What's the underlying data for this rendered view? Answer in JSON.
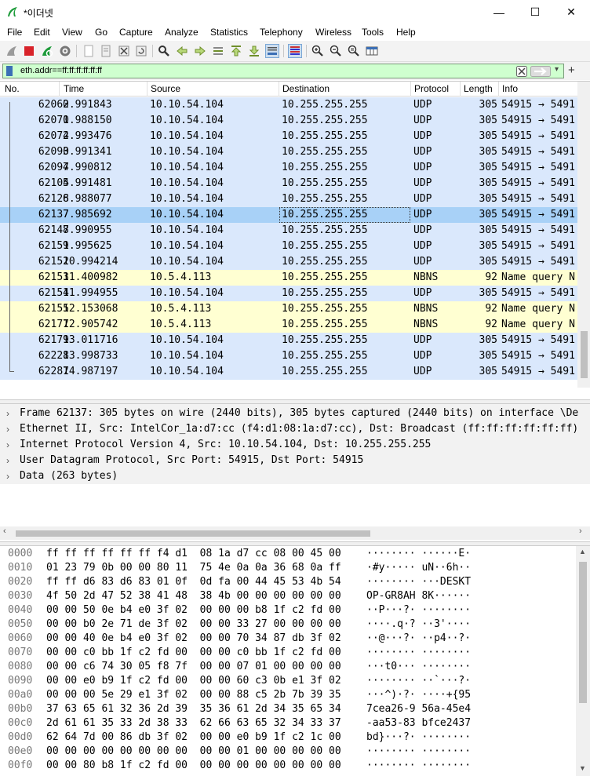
{
  "window": {
    "title": "*이더넷",
    "minimize": "—",
    "maximize": "☐",
    "close": "✕"
  },
  "menu": [
    "File",
    "Edit",
    "View",
    "Go",
    "Capture",
    "Analyze",
    "Statistics",
    "Telephony",
    "Wireless",
    "Tools",
    "Help"
  ],
  "filter": {
    "value": "eth.addr==ff:ff:ff:ff:ff:ff"
  },
  "columns": {
    "no": "No.",
    "time": "Time",
    "source": "Source",
    "destination": "Destination",
    "protocol": "Protocol",
    "length": "Length",
    "info": "Info"
  },
  "packets": [
    {
      "no": "62062",
      "time": "0.991843",
      "src": "10.10.54.104",
      "dst": "10.255.255.255",
      "proto": "UDP",
      "len": "305",
      "info": "54915 → 5491"
    },
    {
      "no": "62070",
      "time": "1.988150",
      "src": "10.10.54.104",
      "dst": "10.255.255.255",
      "proto": "UDP",
      "len": "305",
      "info": "54915 → 5491"
    },
    {
      "no": "62074",
      "time": "2.993476",
      "src": "10.10.54.104",
      "dst": "10.255.255.255",
      "proto": "UDP",
      "len": "305",
      "info": "54915 → 5491"
    },
    {
      "no": "62090",
      "time": "3.991341",
      "src": "10.10.54.104",
      "dst": "10.255.255.255",
      "proto": "UDP",
      "len": "305",
      "info": "54915 → 5491"
    },
    {
      "no": "62097",
      "time": "4.990812",
      "src": "10.10.54.104",
      "dst": "10.255.255.255",
      "proto": "UDP",
      "len": "305",
      "info": "54915 → 5491"
    },
    {
      "no": "62104",
      "time": "5.991481",
      "src": "10.10.54.104",
      "dst": "10.255.255.255",
      "proto": "UDP",
      "len": "305",
      "info": "54915 → 5491"
    },
    {
      "no": "62128",
      "time": "6.988077",
      "src": "10.10.54.104",
      "dst": "10.255.255.255",
      "proto": "UDP",
      "len": "305",
      "info": "54915 → 5491"
    },
    {
      "no": "62137",
      "time": "7.985692",
      "src": "10.10.54.104",
      "dst": "10.255.255.255",
      "proto": "UDP",
      "len": "305",
      "info": "54915 → 5491"
    },
    {
      "no": "62147",
      "time": "8.990955",
      "src": "10.10.54.104",
      "dst": "10.255.255.255",
      "proto": "UDP",
      "len": "305",
      "info": "54915 → 5491"
    },
    {
      "no": "62151",
      "time": "9.995625",
      "src": "10.10.54.104",
      "dst": "10.255.255.255",
      "proto": "UDP",
      "len": "305",
      "info": "54915 → 5491"
    },
    {
      "no": "62152",
      "time": "10.994214",
      "src": "10.10.54.104",
      "dst": "10.255.255.255",
      "proto": "UDP",
      "len": "305",
      "info": "54915 → 5491"
    },
    {
      "no": "62153",
      "time": "11.400982",
      "src": "10.5.4.113",
      "dst": "10.255.255.255",
      "proto": "NBNS",
      "len": "92",
      "info": "Name query N"
    },
    {
      "no": "62154",
      "time": "11.994955",
      "src": "10.10.54.104",
      "dst": "10.255.255.255",
      "proto": "UDP",
      "len": "305",
      "info": "54915 → 5491"
    },
    {
      "no": "62155",
      "time": "12.153068",
      "src": "10.5.4.113",
      "dst": "10.255.255.255",
      "proto": "NBNS",
      "len": "92",
      "info": "Name query N"
    },
    {
      "no": "62177",
      "time": "12.905742",
      "src": "10.5.4.113",
      "dst": "10.255.255.255",
      "proto": "NBNS",
      "len": "92",
      "info": "Name query N"
    },
    {
      "no": "62179",
      "time": "13.011716",
      "src": "10.10.54.104",
      "dst": "10.255.255.255",
      "proto": "UDP",
      "len": "305",
      "info": "54915 → 5491"
    },
    {
      "no": "62228",
      "time": "13.998733",
      "src": "10.10.54.104",
      "dst": "10.255.255.255",
      "proto": "UDP",
      "len": "305",
      "info": "54915 → 5491"
    },
    {
      "no": "62287",
      "time": "14.987197",
      "src": "10.10.54.104",
      "dst": "10.255.255.255",
      "proto": "UDP",
      "len": "305",
      "info": "54915 → 5491"
    }
  ],
  "selected_packet": "62137",
  "colors": {
    "udp": "#dae8fc",
    "nbns": "#ffffd2",
    "selected": "#a8d1f7",
    "filter_ok": "#cfffcf"
  },
  "details": [
    "Frame 62137: 305 bytes on wire (2440 bits), 305 bytes captured (2440 bits) on interface \\De",
    "Ethernet II, Src: IntelCor_1a:d7:cc (f4:d1:08:1a:d7:cc), Dst: Broadcast (ff:ff:ff:ff:ff:ff)",
    "Internet Protocol Version 4, Src: 10.10.54.104, Dst: 10.255.255.255",
    "User Datagram Protocol, Src Port: 54915, Dst Port: 54915",
    "Data (263 bytes)"
  ],
  "bytes": [
    {
      "off": "0000",
      "hex": "ff ff ff ff ff ff f4 d1  08 1a d7 cc 08 00 45 00",
      "ascii": "········ ······E·"
    },
    {
      "off": "0010",
      "hex": "01 23 79 0b 00 00 80 11  75 4e 0a 0a 36 68 0a ff",
      "ascii": "·#y····· uN··6h··"
    },
    {
      "off": "0020",
      "hex": "ff ff d6 83 d6 83 01 0f  0d fa 00 44 45 53 4b 54",
      "ascii": "········ ···DESKT"
    },
    {
      "off": "0030",
      "hex": "4f 50 2d 47 52 38 41 48  38 4b 00 00 00 00 00 00",
      "ascii": "OP-GR8AH 8K······"
    },
    {
      "off": "0040",
      "hex": "00 00 50 0e b4 e0 3f 02  00 00 00 b8 1f c2 fd 00",
      "ascii": "··P···?· ········"
    },
    {
      "off": "0050",
      "hex": "00 00 b0 2e 71 de 3f 02  00 00 33 27 00 00 00 00",
      "ascii": "····.q·? ··3'····"
    },
    {
      "off": "0060",
      "hex": "00 00 40 0e b4 e0 3f 02  00 00 70 34 87 db 3f 02",
      "ascii": "··@···?· ··p4··?·"
    },
    {
      "off": "0070",
      "hex": "00 00 c0 bb 1f c2 fd 00  00 00 c0 bb 1f c2 fd 00",
      "ascii": "········ ········"
    },
    {
      "off": "0080",
      "hex": "00 00 c6 74 30 05 f8 7f  00 00 07 01 00 00 00 00",
      "ascii": "···t0··· ········"
    },
    {
      "off": "0090",
      "hex": "00 00 e0 b9 1f c2 fd 00  00 00 60 c3 0b e1 3f 02",
      "ascii": "········ ··`···?·"
    },
    {
      "off": "00a0",
      "hex": "00 00 00 5e 29 e1 3f 02  00 00 88 c5 2b 7b 39 35",
      "ascii": "···^)·?· ····+{95"
    },
    {
      "off": "00b0",
      "hex": "37 63 65 61 32 36 2d 39  35 36 61 2d 34 35 65 34",
      "ascii": "7cea26-9 56a-45e4"
    },
    {
      "off": "00c0",
      "hex": "2d 61 61 35 33 2d 38 33  62 66 63 65 32 34 33 37",
      "ascii": "-aa53-83 bfce2437"
    },
    {
      "off": "00d0",
      "hex": "62 64 7d 00 86 db 3f 02  00 00 e0 b9 1f c2 1c 00",
      "ascii": "bd}···?· ········"
    },
    {
      "off": "00e0",
      "hex": "00 00 00 00 00 00 00 00  00 00 01 00 00 00 00 00",
      "ascii": "········ ········"
    },
    {
      "off": "00f0",
      "hex": "00 00 80 b8 1f c2 fd 00  00 00 00 00 00 00 00 00",
      "ascii": "········ ········"
    }
  ]
}
